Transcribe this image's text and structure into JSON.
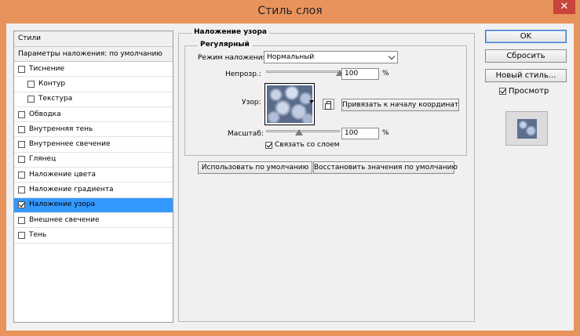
{
  "window": {
    "title": "Стиль слоя",
    "close": "✕"
  },
  "styles": {
    "header": "Стили",
    "blend_options": "Параметры наложения: по умолчанию",
    "items": [
      {
        "label": "Тиснение",
        "checked": false,
        "sub": false
      },
      {
        "label": "Контур",
        "checked": false,
        "sub": true
      },
      {
        "label": "Текстура",
        "checked": false,
        "sub": true
      },
      {
        "label": "Обводка",
        "checked": false,
        "sub": false
      },
      {
        "label": "Внутренняя тень",
        "checked": false,
        "sub": false
      },
      {
        "label": "Внутреннее свечение",
        "checked": false,
        "sub": false
      },
      {
        "label": "Глянец",
        "checked": false,
        "sub": false
      },
      {
        "label": "Наложение цвета",
        "checked": false,
        "sub": false
      },
      {
        "label": "Наложение градиента",
        "checked": false,
        "sub": false
      },
      {
        "label": "Наложение узора",
        "checked": true,
        "sub": false,
        "selected": true
      },
      {
        "label": "Внешнее свечение",
        "checked": false,
        "sub": false
      },
      {
        "label": "Тень",
        "checked": false,
        "sub": false
      }
    ]
  },
  "pattern_overlay": {
    "group_title": "Наложение узора",
    "subgroup_title": "Регулярный",
    "blend_mode_label": "Режим наложения:",
    "blend_mode_value": "Нормальный",
    "opacity_label": "Непрозр.:",
    "opacity_value": "100",
    "opacity_fraction": 1.0,
    "pattern_label": "Узор:",
    "snap_button": "Привязать к началу координат",
    "scale_label": "Масштаб:",
    "scale_value": "100",
    "scale_fraction": 0.45,
    "link_label": "Связать со слоем",
    "link_checked": true,
    "percent": "%",
    "make_default_button": "Использовать по умолчанию",
    "reset_default_button": "Восстановить значения по умолчанию"
  },
  "actions": {
    "ok": "OK",
    "reset": "Сбросить",
    "new_style": "Новый стиль...",
    "preview_label": "Просмотр",
    "preview_checked": true
  },
  "colors": {
    "titlebar": "#e8935c",
    "selection": "#3399ff",
    "close": "#c7453a"
  }
}
